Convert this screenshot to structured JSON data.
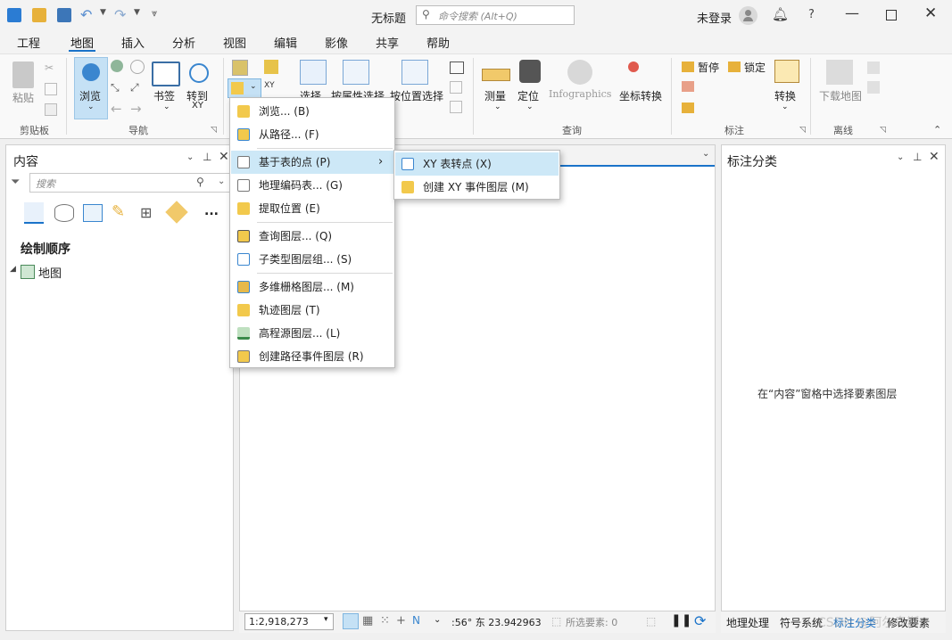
{
  "window": {
    "title": "无标题",
    "user": "未登录",
    "help": "?"
  },
  "search": {
    "placeholder": "命令搜索 (Alt+Q)"
  },
  "tabs": [
    "工程",
    "地图",
    "插入",
    "分析",
    "视图",
    "编辑",
    "影像",
    "共享",
    "帮助"
  ],
  "ribbon": {
    "paste": "粘贴",
    "clipboard": "剪贴板",
    "explore": "浏览",
    "bookmarks": "书签",
    "goto": "转到",
    "goto_sub": "XY",
    "navigate": "导航",
    "select": "选择",
    "select_by_attr": "按属性选择",
    "select_by_loc": "按位置选择",
    "measure": "测量",
    "locate": "定位",
    "infographics": "Infographics",
    "coord_convert": "坐标转换",
    "inquiry": "查询",
    "pause": "暂停",
    "lock": "锁定",
    "convert": "转换",
    "labeling": "标注",
    "download_map": "下载地图",
    "offline": "离线"
  },
  "contents": {
    "title": "内容",
    "search_placeholder": "搜索",
    "draw_order": "绘制顺序",
    "map_item": "地图",
    "more": "..."
  },
  "add_data_menu": {
    "items": [
      {
        "label": "浏览... (B)"
      },
      {
        "label": "从路径... (F)"
      },
      {
        "label": "基于表的点 (P)"
      },
      {
        "label": "地理编码表... (G)"
      },
      {
        "label": "提取位置 (E)"
      },
      {
        "label": "查询图层... (Q)"
      },
      {
        "label": "子类型图层组... (S)"
      },
      {
        "label": "多维栅格图层... (M)"
      },
      {
        "label": "轨迹图层 (T)"
      },
      {
        "label": "高程源图层... (L)"
      },
      {
        "label": "创建路径事件图层 (R)"
      }
    ],
    "submenu_arrow": "›"
  },
  "submenu": {
    "items": [
      {
        "label": "XY 表转点 (X)"
      },
      {
        "label": "创建 XY 事件图层 (M)"
      }
    ]
  },
  "label_class": {
    "title": "标注分类",
    "message": "在“内容”窗格中选择要素图层"
  },
  "statusbar": {
    "scale": "1:2,918,273",
    "coords": ":56° 东 23.942963",
    "selected": "所选要素: 0"
  },
  "bottom_tabs": [
    "地理处理",
    "符号系统",
    "标注分类",
    "修改要素"
  ],
  "watermark": "CSDN @阿尔卑斯",
  "colors": {
    "accent": "#1a73c9",
    "highlight": "#cde8f7",
    "selected_tool": "#c5e1f5"
  }
}
